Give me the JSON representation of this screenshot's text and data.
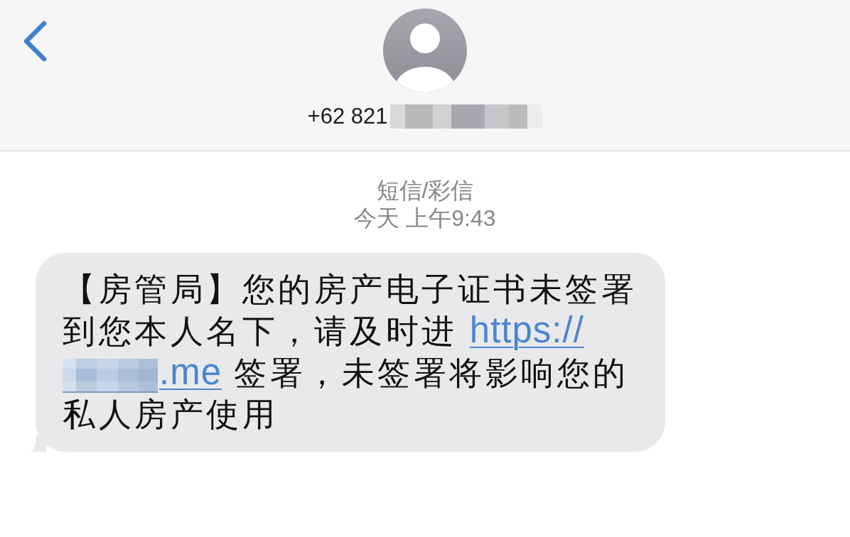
{
  "header": {
    "contact": {
      "number": "+62 821",
      "number_redacted": true
    }
  },
  "conversation": {
    "service": "短信/彩信",
    "timestamp": "今天 上午9:43",
    "messages": [
      {
        "kind": "incoming",
        "lines": [
          [
            {
              "kind": "text",
              "text": "【房管局】您的房产电子证书未签署"
            }
          ],
          [
            {
              "kind": "text",
              "text": "到您本人名下，请及时进 "
            },
            {
              "kind": "link",
              "text": "https://"
            }
          ],
          [
            {
              "kind": "redacted"
            },
            {
              "kind": "link",
              "text": ".me"
            },
            {
              "kind": "text",
              "text": " 签署，未签署将影响您的"
            }
          ],
          [
            {
              "kind": "text",
              "text": "私人房产使用"
            }
          ]
        ]
      }
    ]
  }
}
